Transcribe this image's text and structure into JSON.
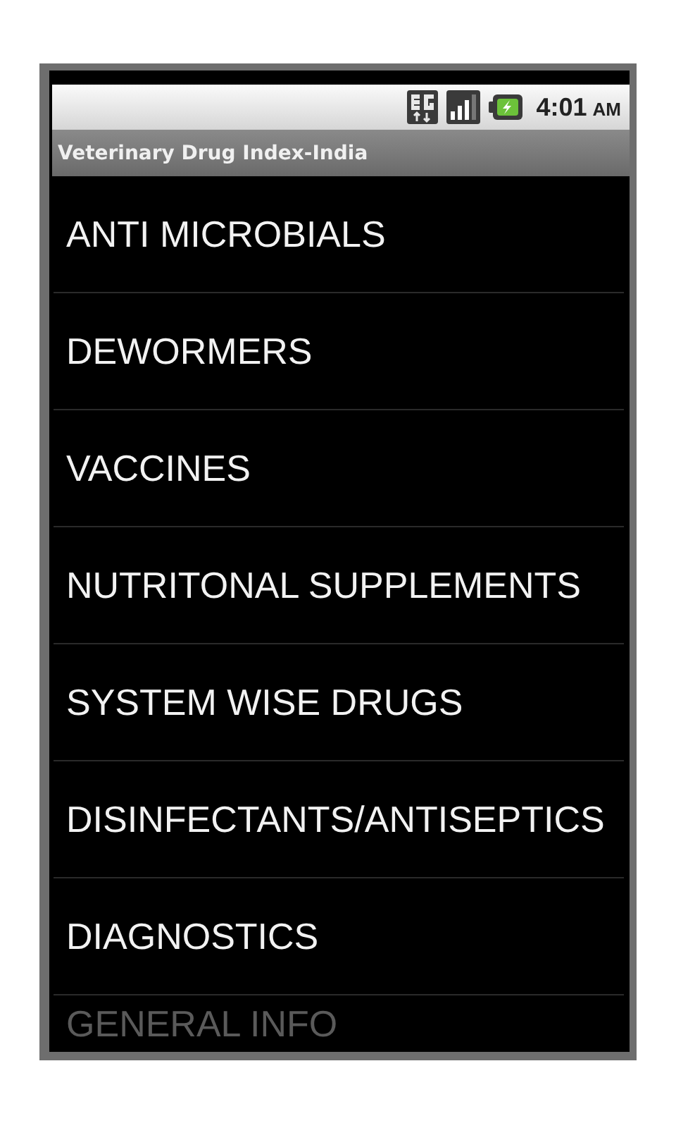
{
  "status_bar": {
    "time": "4:01",
    "meridiem": "AM"
  },
  "title_bar": {
    "title": "Veterinary Drug Index-India"
  },
  "menu": {
    "items": [
      {
        "label": "ANTI MICROBIALS",
        "kind": "item"
      },
      {
        "label": "DEWORMERS",
        "kind": "item"
      },
      {
        "label": "VACCINES",
        "kind": "item"
      },
      {
        "label": "NUTRITONAL SUPPLEMENTS",
        "kind": "item"
      },
      {
        "label": "SYSTEM WISE DRUGS",
        "kind": "item"
      },
      {
        "label": "DISINFECTANTS/ANTISEPTICS",
        "kind": "item"
      },
      {
        "label": "DIAGNOSTICS",
        "kind": "item"
      },
      {
        "label": "GENERAL INFO",
        "kind": "faded"
      }
    ]
  }
}
